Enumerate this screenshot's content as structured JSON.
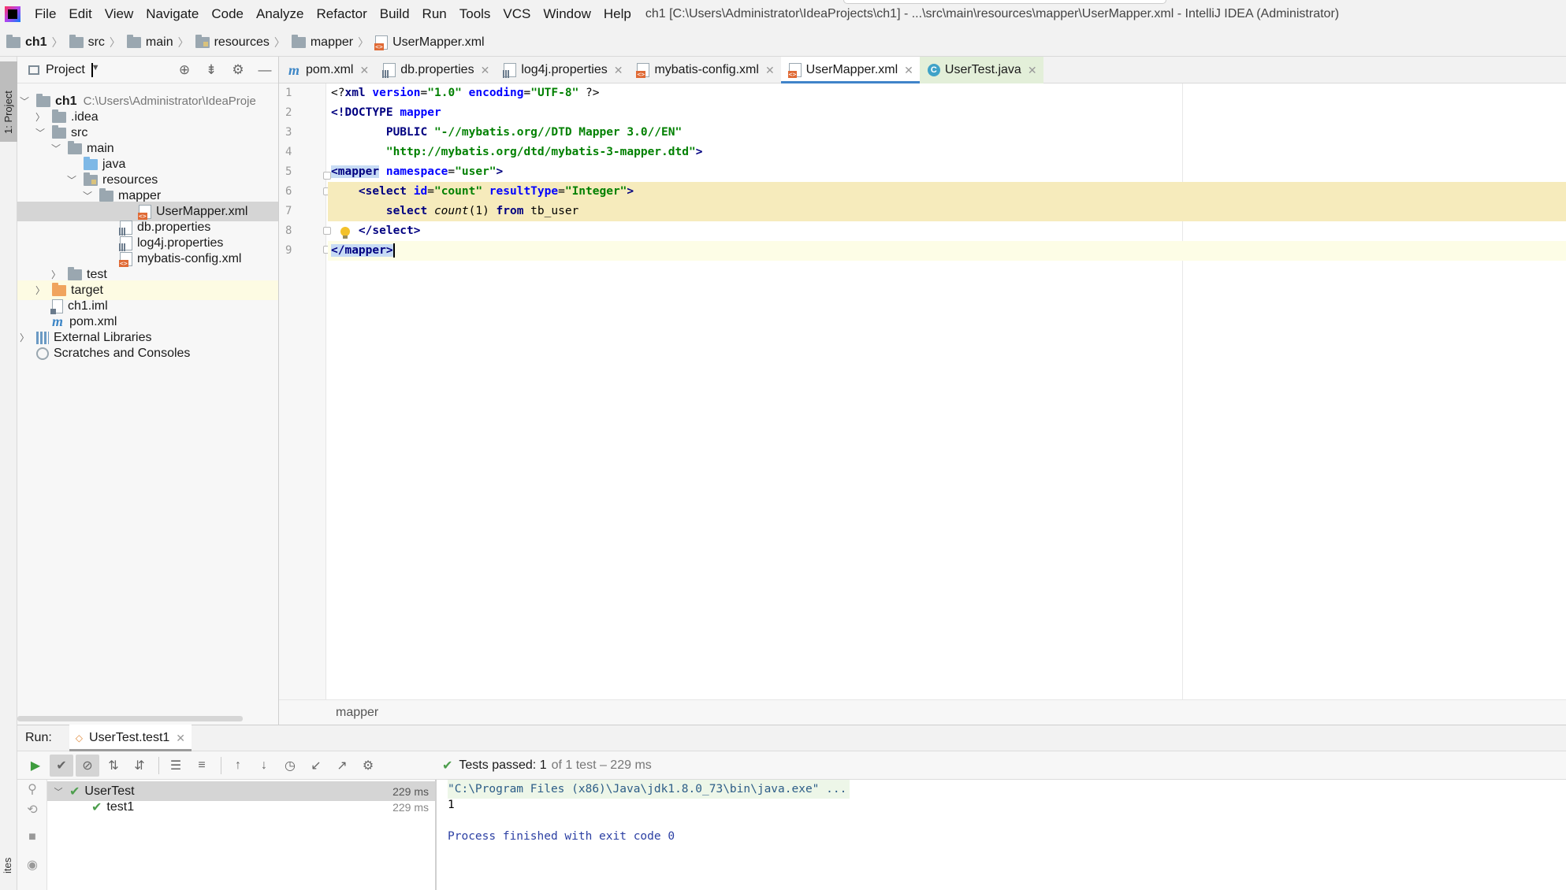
{
  "menubar": {
    "items": [
      "File",
      "Edit",
      "View",
      "Navigate",
      "Code",
      "Analyze",
      "Refactor",
      "Build",
      "Run",
      "Tools",
      "VCS",
      "Window",
      "Help"
    ],
    "window_title": "ch1 [C:\\Users\\Administrator\\IdeaProjects\\ch1] - ...\\src\\main\\resources\\mapper\\UserMapper.xml - IntelliJ IDEA (Administrator)"
  },
  "breadcrumb": [
    "ch1",
    "src",
    "main",
    "resources",
    "mapper",
    "UserMapper.xml"
  ],
  "left_strip": {
    "project_label": "1: Project",
    "bottom_label": "ites"
  },
  "project_panel": {
    "title": "Project",
    "root_name": "ch1",
    "root_path": "C:\\Users\\Administrator\\IdeaProje",
    "items": {
      "idea": ".idea",
      "src": "src",
      "main": "main",
      "java": "java",
      "resources": "resources",
      "mapper": "mapper",
      "usermapper": "UserMapper.xml",
      "db": "db.properties",
      "log4j": "log4j.properties",
      "mybatis": "mybatis-config.xml",
      "test": "test",
      "target": "target",
      "iml": "ch1.iml",
      "pom": "pom.xml",
      "extlib": "External Libraries",
      "scratches": "Scratches and Consoles"
    }
  },
  "tabs": [
    "pom.xml",
    "db.properties",
    "log4j.properties",
    "mybatis-config.xml",
    "UserMapper.xml",
    "UserTest.java"
  ],
  "active_tab": "UserMapper.xml",
  "editor": {
    "line_numbers": [
      "1",
      "2",
      "3",
      "4",
      "5",
      "6",
      "7",
      "8",
      "9"
    ],
    "code": {
      "l1_a": "<?",
      "l1_b": "xml",
      "l1_c": " version",
      "l1_d": "=",
      "l1_e": "\"1.0\"",
      "l1_f": " encoding",
      "l1_g": "=",
      "l1_h": "\"UTF-8\"",
      "l1_i": " ?>",
      "l2_a": "<!DOCTYPE ",
      "l2_b": "mapper",
      "l3_a": "        PUBLIC ",
      "l3_b": "\"-//mybatis.org//DTD Mapper 3.0//EN\"",
      "l4_a": "        ",
      "l4_b": "\"http://mybatis.org/dtd/mybatis-3-mapper.dtd\"",
      "l4_c": ">",
      "l5_a": "<mapper",
      "l5_b": " namespace",
      "l5_c": "=",
      "l5_d": "\"user\"",
      "l5_e": ">",
      "l6_a": "    <select",
      "l6_b": " id",
      "l6_c": "=",
      "l6_d": "\"count\"",
      "l6_e": " resultType",
      "l6_f": "=",
      "l6_g": "\"Integer\"",
      "l6_h": ">",
      "l7_a": "        select ",
      "l7_b": "count",
      "l7_c": "(1) ",
      "l7_d": "from",
      "l7_e": " tb_user",
      "l8_a": "    </select>",
      "l9_a": "</mapper>"
    },
    "breadcrumb": "mapper"
  },
  "run": {
    "label": "Run:",
    "tab": "UserTest.test1",
    "status_label": "Tests passed:",
    "status_count": "1",
    "status_rest": "of 1 test – 229 ms",
    "tests": [
      {
        "name": "UserTest",
        "time": "229 ms"
      },
      {
        "name": "test1",
        "time": "229 ms"
      }
    ],
    "console": [
      "\"C:\\Program Files (x86)\\Java\\jdk1.8.0_73\\bin\\java.exe\" ...",
      "1",
      "",
      "Process finished with exit code 0"
    ]
  },
  "colors": {
    "accent": "#4083c9",
    "line_highlight": "#f6ebbc",
    "tag": "#000080",
    "attr": "#0000ff",
    "string": "#008000",
    "pass_green": "#4d9e4d"
  }
}
